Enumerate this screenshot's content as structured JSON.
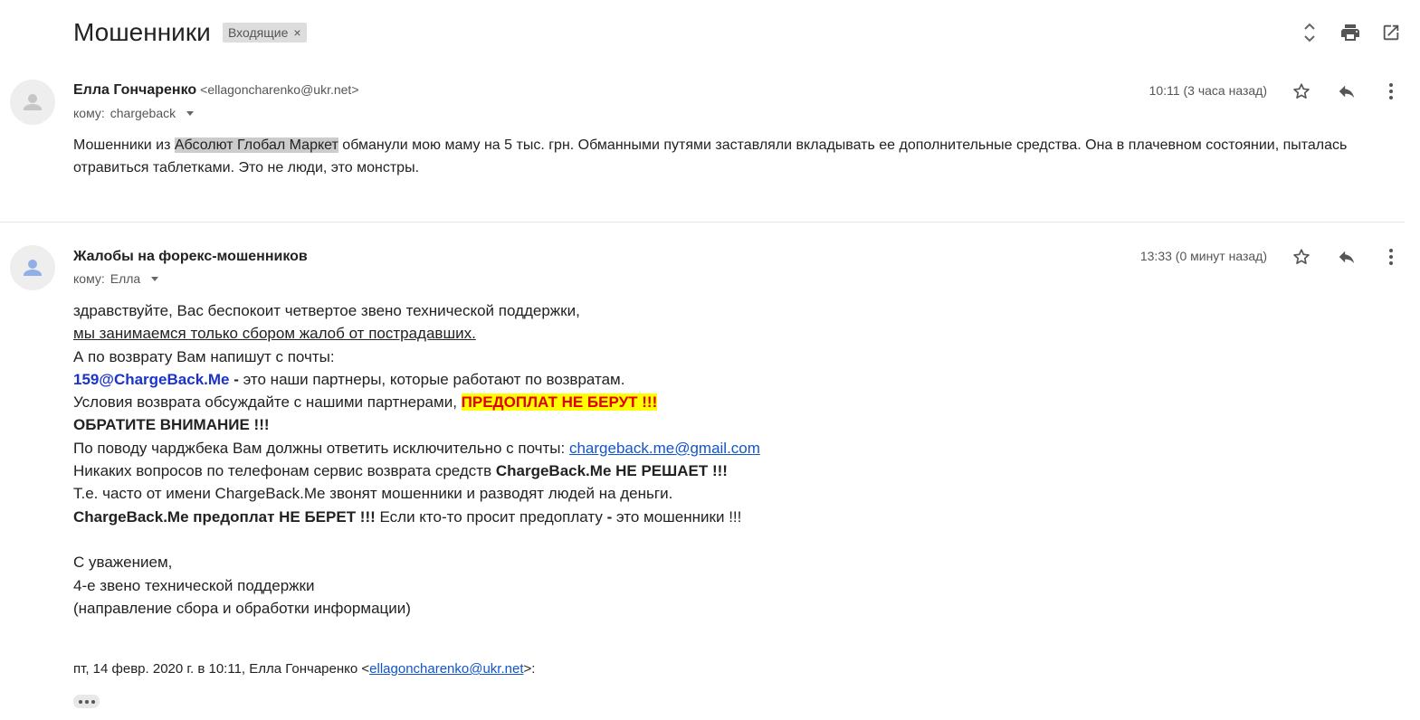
{
  "header": {
    "subject": "Мошенники",
    "label": "Входящие",
    "label_remove": "×"
  },
  "messages": [
    {
      "sender_name": "Елла Гончаренко",
      "sender_email": "<ellagoncharenko@ukr.net>",
      "to_prefix": "кому:",
      "to_name": "chargeback",
      "time": "10:11 (3 часа назад)",
      "body": {
        "before": "Мошенники из ",
        "highlight": "Абсолют Глобал Маркет",
        "after_line1": " обманули мою маму на 5 тыс. грн. Обманными путями заставляли вкладывать ее дополнительные средства. Она в плачевном состоянии, пыталась",
        "line2": "отравиться таблетками. Это не люди, это монстры."
      }
    },
    {
      "sender_name": "Жалобы на форекс-мошенников",
      "to_prefix": "кому:",
      "to_name": "Елла",
      "time": "13:33 (0 минут назад)",
      "body": {
        "l1": "здравствуйте, Вас беспокоит четвертое звено технической поддержки,",
        "l2": "мы занимаемся только сбором жалоб от пострадавших.",
        "l3": "А по возврату Вам напишут с почты:",
        "l4_email": "159@ChargeBack.Me",
        "l4_dash": " - ",
        "l4_rest": "это наши партнеры, которые работают по возвратам.",
        "l5_text": "Условия возврата обсуждайте с нашими партнерами, ",
        "l5_hl": "ПРЕДОПЛАТ НЕ БЕРУТ !!!",
        "l6": "ОБРАТИТЕ ВНИМАНИЕ !!!",
        "l7_text": "По поводу чарджбека Вам должны ответить исключительно с почты: ",
        "l7_link": "chargeback.me@gmail.com",
        "l8_text": "Никаких вопросов по телефонам сервис возврата средств ",
        "l8_bold": "ChargeBack.Me НЕ РЕШАЕТ !!!",
        "l9": "Т.е. часто от имени ChargeBack.Me звонят мошенники и разводят людей на деньги.",
        "l10_bold": "ChargeBack.Me предоплат НЕ БЕРЕТ !!!",
        "l10_text": " Если кто-то просит предоплату ",
        "l10_dash": "-",
        "l10_end": " это мошенники !!!",
        "l12": "С уважением,",
        "l13": "4-е звено технической поддержки",
        "l14": "(направление сбора и обработки информации)"
      },
      "quote": {
        "prefix": "пт, 14 февр. 2020 г. в 10:11, Елла Гончаренко <",
        "email": "ellagoncharenko@ukr.net",
        "suffix": ">:"
      }
    }
  ],
  "icons": {
    "expand": "unfold-icon",
    "print": "print-icon",
    "popout": "open-in-new-window-icon",
    "star": "star-icon",
    "reply": "reply-icon",
    "more": "more-vertical-icon",
    "avatar": "person-avatar-icon",
    "trimmed": "show-trimmed-content-icon"
  }
}
